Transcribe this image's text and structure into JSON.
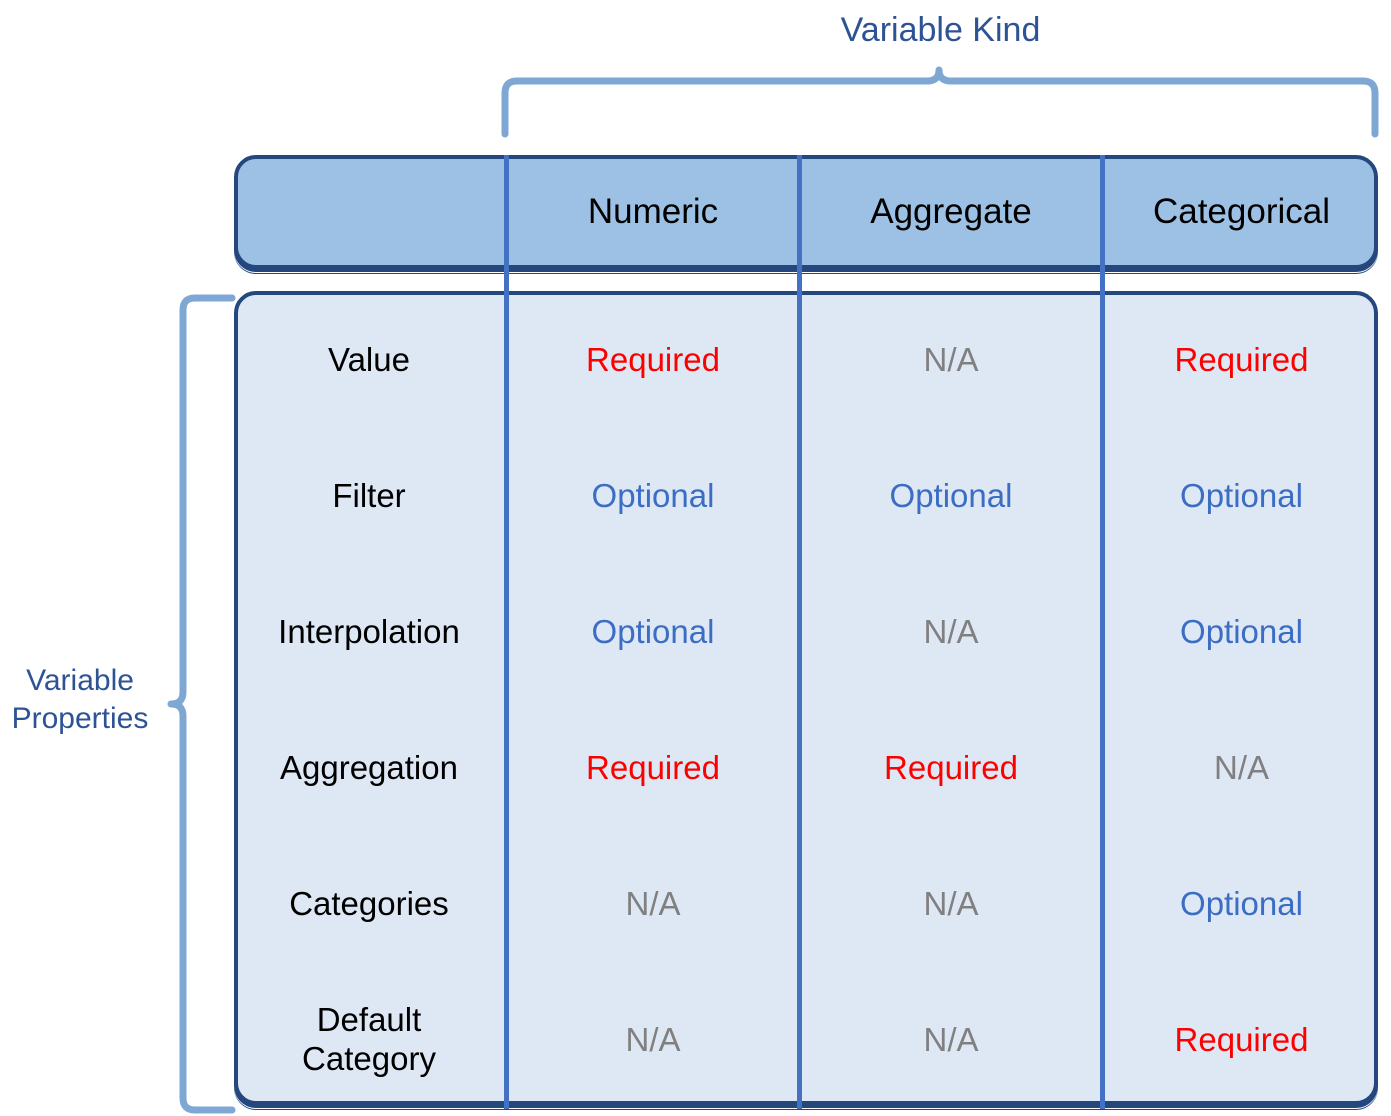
{
  "diagram": {
    "title_top": "Variable Kind",
    "title_left": "Variable\nProperties",
    "colors": {
      "header_fill": "#9DC1E5",
      "body_fill": "#DEE8F5",
      "panel_border": "#24477E",
      "divider": "#4372C4",
      "brace": "#7FA7D4",
      "label_blue": "#2E5395",
      "required": "#FF0000",
      "optional": "#3B6DC4",
      "na": "#808080"
    }
  },
  "chart_data": {
    "type": "table",
    "title": "Variable Kind",
    "row_group_label": "Variable Properties",
    "columns": [
      "",
      "Numeric",
      "Aggregate",
      "Categorical"
    ],
    "rows": [
      {
        "property": "Value",
        "numeric": "Required",
        "aggregate": "N/A",
        "categorical": "Required",
        "numeric_state": "required",
        "aggregate_state": "na",
        "categorical_state": "required"
      },
      {
        "property": "Filter",
        "numeric": "Optional",
        "aggregate": "Optional",
        "categorical": "Optional",
        "numeric_state": "optional",
        "aggregate_state": "optional",
        "categorical_state": "optional"
      },
      {
        "property": "Interpolation",
        "numeric": "Optional",
        "aggregate": "N/A",
        "categorical": "Optional",
        "numeric_state": "optional",
        "aggregate_state": "na",
        "categorical_state": "optional"
      },
      {
        "property": "Aggregation",
        "numeric": "Required",
        "aggregate": "Required",
        "categorical": "N/A",
        "numeric_state": "required",
        "aggregate_state": "required",
        "categorical_state": "na"
      },
      {
        "property": "Categories",
        "numeric": "N/A",
        "aggregate": "N/A",
        "categorical": "Optional",
        "numeric_state": "na",
        "aggregate_state": "na",
        "categorical_state": "optional"
      },
      {
        "property": "Default\nCategory",
        "numeric": "N/A",
        "aggregate": "N/A",
        "categorical": "Required",
        "numeric_state": "na",
        "aggregate_state": "na",
        "categorical_state": "required"
      }
    ]
  },
  "header": {
    "col1": "Numeric",
    "col2": "Aggregate",
    "col3": "Categorical"
  }
}
